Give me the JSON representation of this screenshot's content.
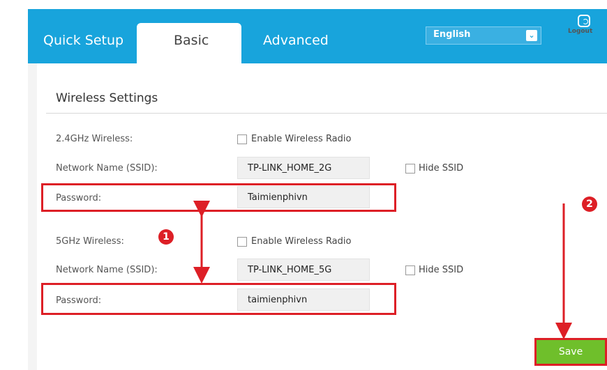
{
  "nav": {
    "tabs": [
      {
        "label": "Quick Setup"
      },
      {
        "label": "Basic"
      },
      {
        "label": "Advanced"
      }
    ],
    "language": "English",
    "logout_label": "Logout"
  },
  "section_title": "Wireless Settings",
  "band24": {
    "label": "2.4GHz Wireless:",
    "enable_label": "Enable Wireless Radio",
    "ssid_label": "Network Name (SSID):",
    "ssid_value": "TP-LINK_HOME_2G",
    "hide_label": "Hide SSID",
    "password_label": "Password:",
    "password_value": "Taimienphivn"
  },
  "band5": {
    "label": "5GHz Wireless:",
    "enable_label": "Enable Wireless Radio",
    "ssid_label": "Network Name (SSID):",
    "ssid_value": "TP-LINK_HOME_5G",
    "hide_label": "Hide SSID",
    "password_label": "Password:",
    "password_value": "taimienphivn"
  },
  "annotations": {
    "badge1": "1",
    "badge2": "2"
  },
  "save_label": "Save",
  "colors": {
    "header_blue": "#18a4dc",
    "highlight_red": "#dd1f26",
    "save_green": "#6fbf2b"
  }
}
